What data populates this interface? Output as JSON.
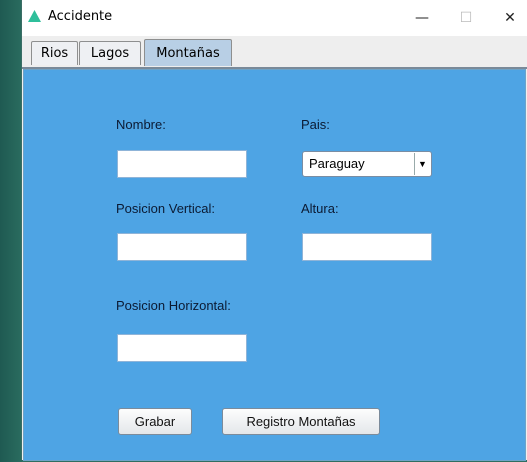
{
  "window": {
    "title": "Accidente",
    "minimize_glyph": "—",
    "maximize_glyph": "☐",
    "close_glyph": "✕",
    "icon": "green-triangle-icon"
  },
  "tabs": [
    {
      "label": "Rios",
      "active": false
    },
    {
      "label": "Lagos",
      "active": false
    },
    {
      "label": "Montañas",
      "active": true
    }
  ],
  "form": {
    "nombre_label": "Nombre:",
    "nombre_value": "",
    "pais_label": "Pais:",
    "pais_selected": "Paraguay",
    "pos_vertical_label": "Posicion Vertical:",
    "pos_vertical_value": "",
    "altura_label": "Altura:",
    "altura_value": "",
    "pos_horizontal_label": "Posicion Horizontal:",
    "pos_horizontal_value": ""
  },
  "buttons": {
    "grabar": "Grabar",
    "registro": "Registro Montañas"
  },
  "colors": {
    "panel": "#4ea4e4",
    "active_tab": "#b8cfe5",
    "app_icon": "#2fbf9b"
  }
}
